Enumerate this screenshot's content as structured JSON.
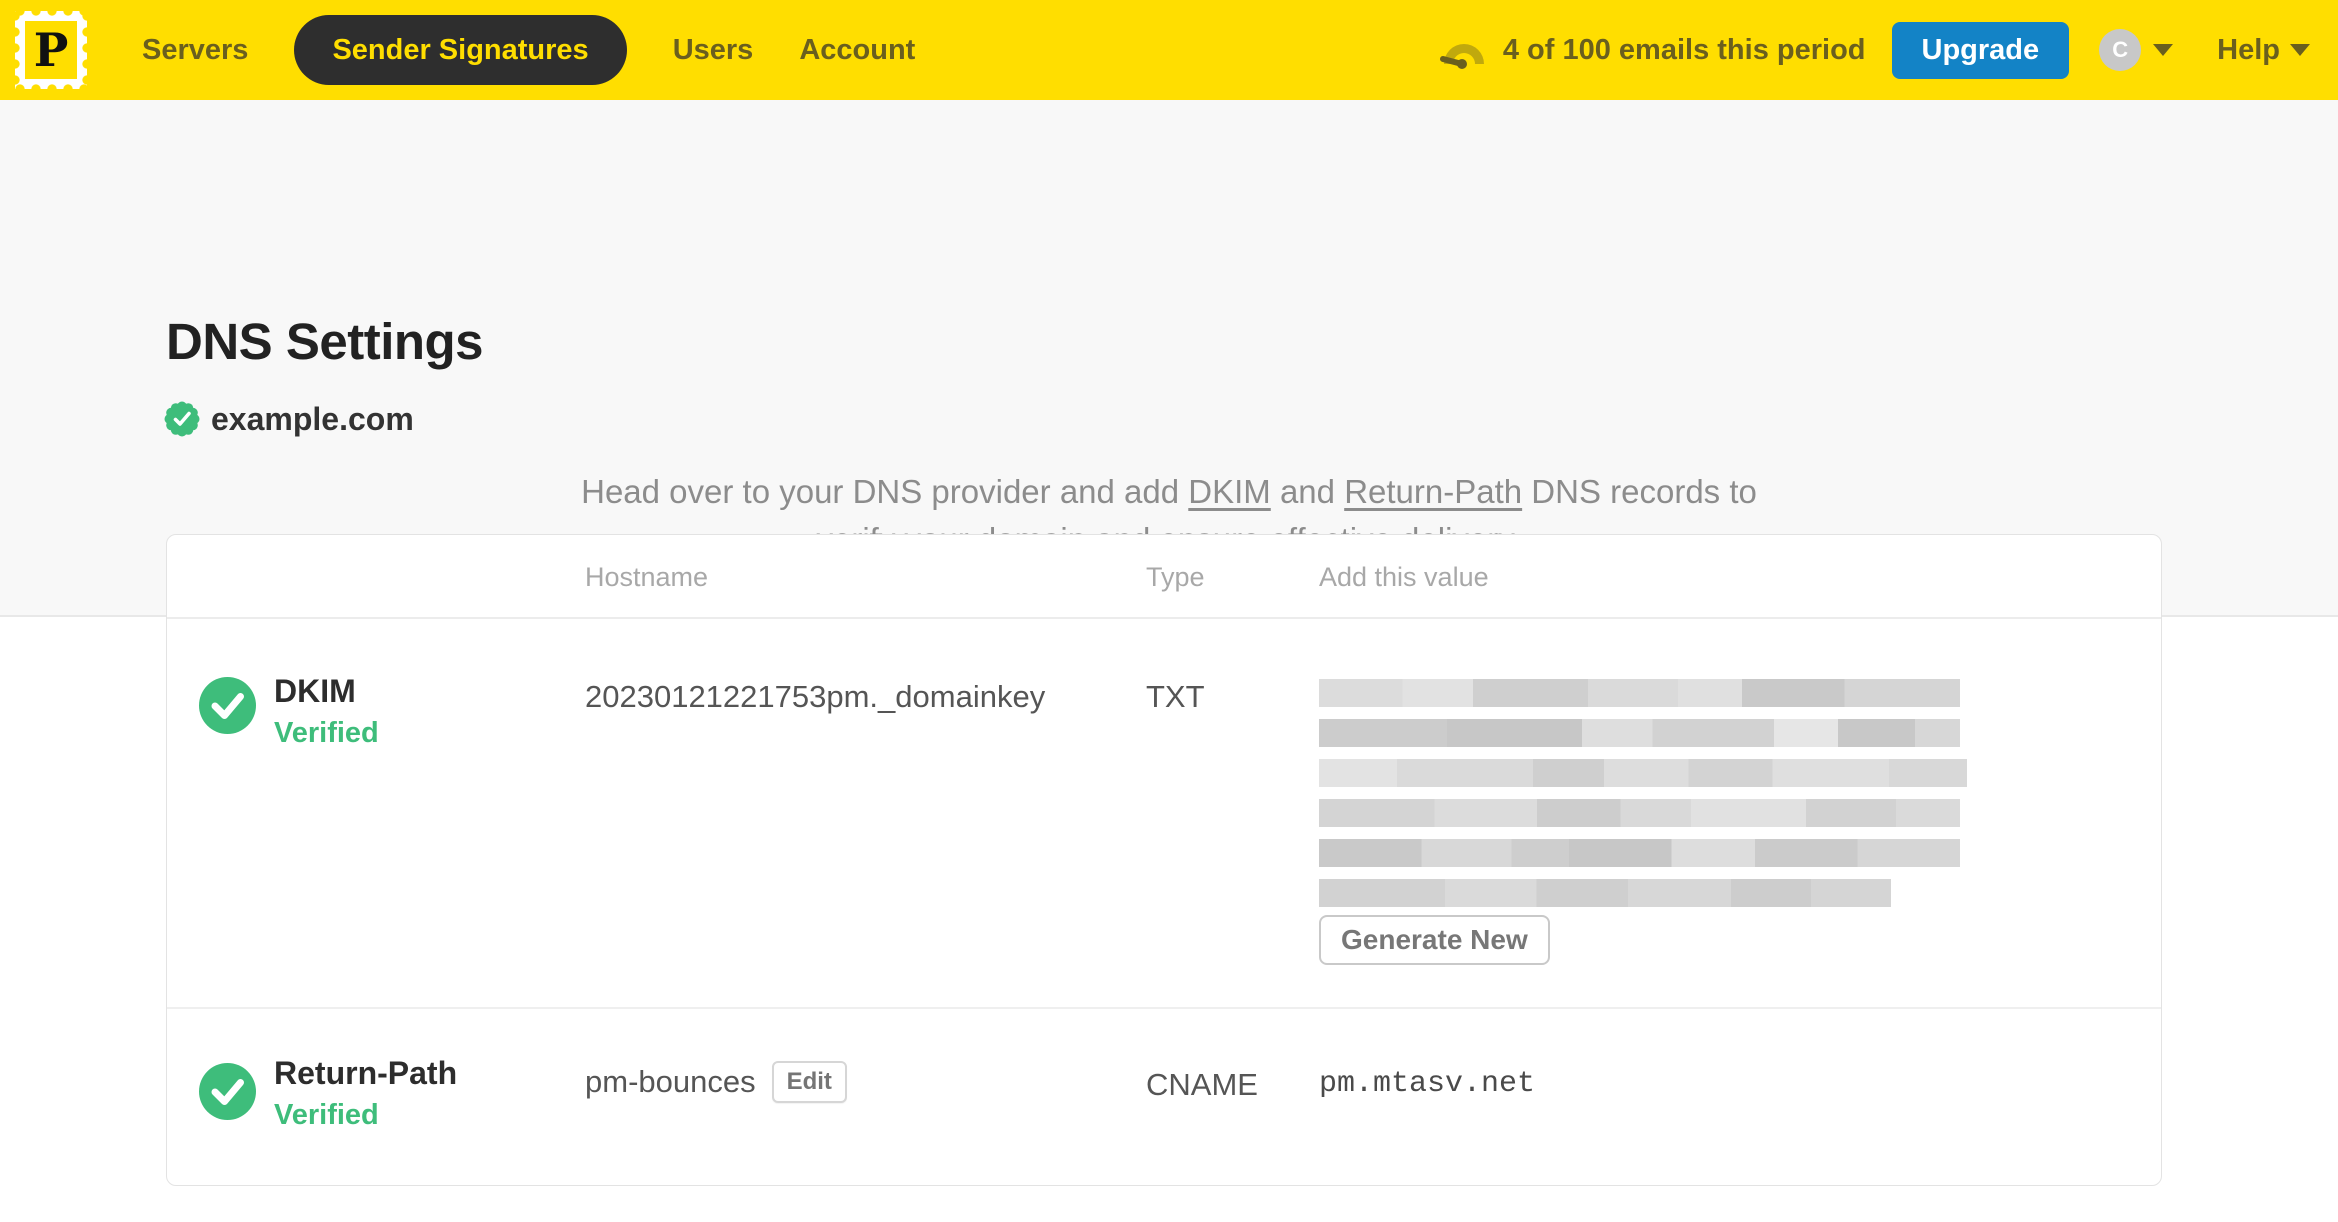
{
  "nav": {
    "logo_letter": "P",
    "items": [
      {
        "label": "Servers",
        "active": false
      },
      {
        "label": "Sender Signatures",
        "active": true
      },
      {
        "label": "Users",
        "active": false
      },
      {
        "label": "Account",
        "active": false
      }
    ],
    "usage_text": "4 of 100 emails this period",
    "upgrade_label": "Upgrade",
    "avatar_initial": "C",
    "help_label": "Help"
  },
  "page": {
    "title": "DNS Settings",
    "domain": "example.com",
    "domain_verified": true,
    "intro": {
      "part1": "Head over to your DNS provider and add ",
      "dkim_link": "DKIM",
      "part2": " and ",
      "return_path_link": "Return-Path",
      "part3": " DNS records to",
      "part4": "verify your domain and ensure effective delivery."
    }
  },
  "table": {
    "headers": {
      "hostname": "Hostname",
      "type": "Type",
      "value": "Add this value"
    },
    "rows": [
      {
        "name": "DKIM",
        "status": "Verified",
        "hostname": "20230121221753pm._domainkey",
        "type": "TXT",
        "value_redacted": true,
        "action_label": "Generate New"
      },
      {
        "name": "Return-Path",
        "status": "Verified",
        "hostname": "pm-bounces",
        "edit_label": "Edit",
        "type": "CNAME",
        "value": "pm.mtasv.net"
      }
    ]
  },
  "colors": {
    "brand_yellow": "#ffde00",
    "nav_ink": "#6a5f1e",
    "active_pill": "#2e2e2e",
    "upgrade_blue": "#1383c6",
    "verified_green": "#3ebd7b"
  }
}
